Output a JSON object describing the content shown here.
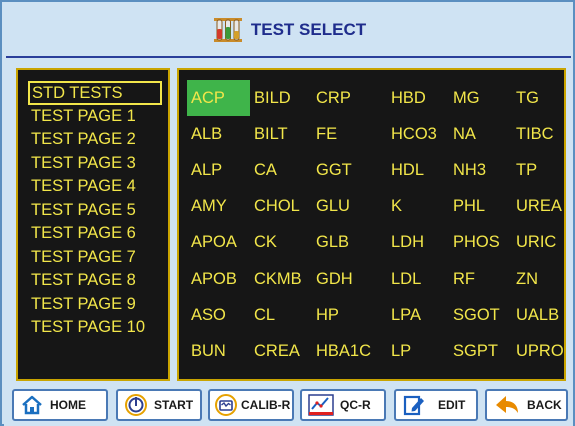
{
  "header": {
    "title": "TEST SELECT",
    "icon": "test-tubes-icon"
  },
  "pages": {
    "items": [
      {
        "label": "STD TESTS",
        "selected": true
      },
      {
        "label": "TEST PAGE 1"
      },
      {
        "label": "TEST PAGE 2"
      },
      {
        "label": "TEST PAGE 3"
      },
      {
        "label": "TEST PAGE 4"
      },
      {
        "label": "TEST PAGE 5"
      },
      {
        "label": "TEST PAGE 6"
      },
      {
        "label": "TEST PAGE 7"
      },
      {
        "label": "TEST PAGE 8"
      },
      {
        "label": "TEST PAGE 9"
      },
      {
        "label": "TEST PAGE 10"
      }
    ]
  },
  "tests": {
    "selected": "ACP",
    "rows": [
      [
        "ACP",
        "BILD",
        "CRP",
        "HBD",
        "MG",
        "TG"
      ],
      [
        "ALB",
        "BILT",
        "FE",
        "HCO3",
        "NA",
        "TIBC"
      ],
      [
        "ALP",
        "CA",
        "GGT",
        "HDL",
        "NH3",
        "TP"
      ],
      [
        "AMY",
        "CHOL",
        "GLU",
        "K",
        "PHL",
        "UREA"
      ],
      [
        "APOA",
        "CK",
        "GLB",
        "LDH",
        "PHOS",
        "URIC"
      ],
      [
        "APOB",
        "CKMB",
        "GDH",
        "LDL",
        "RF",
        "ZN"
      ],
      [
        "ASO",
        "CL",
        "HP",
        "LPA",
        "SGOT",
        "UALB"
      ],
      [
        "BUN",
        "CREA",
        "HBA1C",
        "LP",
        "SGPT",
        "UPRO"
      ]
    ]
  },
  "buttons": {
    "home": {
      "label": "HOME",
      "icon": "home-icon"
    },
    "start": {
      "label": "START",
      "icon": "start-icon"
    },
    "calib": {
      "label": "CALIB-R",
      "icon": "calibration-icon"
    },
    "qc": {
      "label": "QC-R",
      "icon": "qc-chart-icon"
    },
    "edit": {
      "label": "EDIT",
      "icon": "edit-icon"
    },
    "back": {
      "label": "BACK",
      "icon": "back-arrow-icon"
    }
  },
  "colors": {
    "background": "#cfe3f3",
    "panel": "#161616",
    "panel_border": "#c9a400",
    "text": "#f2e64a",
    "selection": "#3fb44a",
    "title": "#1f2d8c"
  }
}
